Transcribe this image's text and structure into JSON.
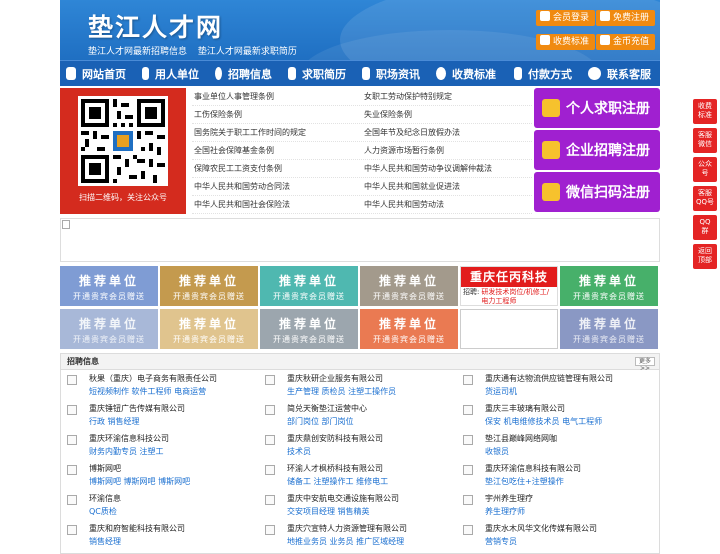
{
  "header": {
    "logo": "垫江人才网",
    "tagline": [
      "垫江人才网最新招聘信息",
      "垫江人才网最新求职简历"
    ],
    "buttons": {
      "member_login": "会员登录",
      "free_register": "免费注册",
      "fee_standard": "收费标准",
      "coin_recharge": "金币充值"
    }
  },
  "nav": {
    "items": [
      "网站首页",
      "用人单位",
      "招聘信息",
      "求职简历",
      "职场资讯",
      "收费标准",
      "付款方式",
      "联系客服"
    ]
  },
  "qr": {
    "caption": "扫描二维码，关注公众号"
  },
  "links": [
    [
      "事业单位人事管理条例",
      "女职工劳动保护特别规定"
    ],
    [
      "工伤保险条例",
      "失业保险条例"
    ],
    [
      "国务院关于职工工作时间的规定",
      "全国年节及纪念日放假办法"
    ],
    [
      "全国社会保障基金条例",
      "人力资源市场暂行条例"
    ],
    [
      "保障农民工工资支付条例",
      "中华人民共和国劳动争议调解仲裁法"
    ],
    [
      "中华人民共和国劳动合同法",
      "中华人民共和国就业促进法"
    ],
    [
      "中华人民共和国社会保险法",
      "中华人民共和国劳动法"
    ]
  ],
  "register": {
    "personal": "个人求职注册",
    "company": "企业招聘注册",
    "wechat": "微信扫码注册"
  },
  "ads": {
    "title": "推荐单位",
    "subtitle": "开通贵宾会员赠送",
    "special": {
      "name": "重庆任丙科技",
      "label": "招聘:",
      "jobs": "研发技术岗位/机修工/电力工程师"
    },
    "colors": [
      "#7f9cd4",
      "#c49a4e",
      "#4fb8b0",
      "#a39a8c",
      "#47b06a",
      "#a8b8d8",
      "#e0c48e",
      "#9ca6ae",
      "#ea7a52",
      "#8a98c4",
      "#d7d2c6"
    ]
  },
  "jobs": {
    "title": "招聘信息",
    "more": "更多>>",
    "items": [
      {
        "company": "秋果（重庆）电子商务有限责任公司",
        "positions": "短视频制作 软件工程师 电商运营"
      },
      {
        "company": "重庆秋研企业服务有限公司",
        "positions": "生产管理 质检员 注塑工操作员"
      },
      {
        "company": "重庆通有达物流供应链管理有限公司",
        "positions": "货运司机"
      },
      {
        "company": "重庆锤钮广告传媒有限公司",
        "positions": "行政 销售经理"
      },
      {
        "company": "简兑天衡垫江运营中心",
        "positions": "部门岗位 部门岗位"
      },
      {
        "company": "重庆三丰玻璃有限公司",
        "positions": "保安 机电维修技术员 电气工程师"
      },
      {
        "company": "重庆环渝信息科技公司",
        "positions": "财务内勤专员 注塑工"
      },
      {
        "company": "重庆鼎创安防科技有限公司",
        "positions": "技术员"
      },
      {
        "company": "垫江县巅峰网络网咖",
        "positions": "收银员"
      },
      {
        "company": "博斯网吧",
        "positions": "博斯网吧 博斯网吧 博斯网吧"
      },
      {
        "company": "环渝人才枫桥科技有限公司",
        "positions": "储备工 注塑操作工 维修电工"
      },
      {
        "company": "重庆环渝信息科技有限公司",
        "positions": "垫江包吃住+注塑操作"
      },
      {
        "company": "环渝信息",
        "positions": "QC质检"
      },
      {
        "company": "重庆中安航电交通设施有限公司",
        "positions": "交安项目经理 销售精英"
      },
      {
        "company": "宇州养生理疗",
        "positions": "养生理疗师"
      },
      {
        "company": "重庆和府智能科技有限公司",
        "positions": "销售经理"
      },
      {
        "company": "重庆穴宣特人力资源管理有限公司",
        "positions": "地推业务员 业务员 推广区域经理"
      },
      {
        "company": "重庆水木风华文化传媒有限公司",
        "positions": "营销专员"
      }
    ]
  },
  "side": {
    "items": [
      "收费\n标准",
      "客服\n微信",
      "公众\n号",
      "客服\nQQ号",
      "QQ\n群",
      "返回\n顶部"
    ]
  }
}
